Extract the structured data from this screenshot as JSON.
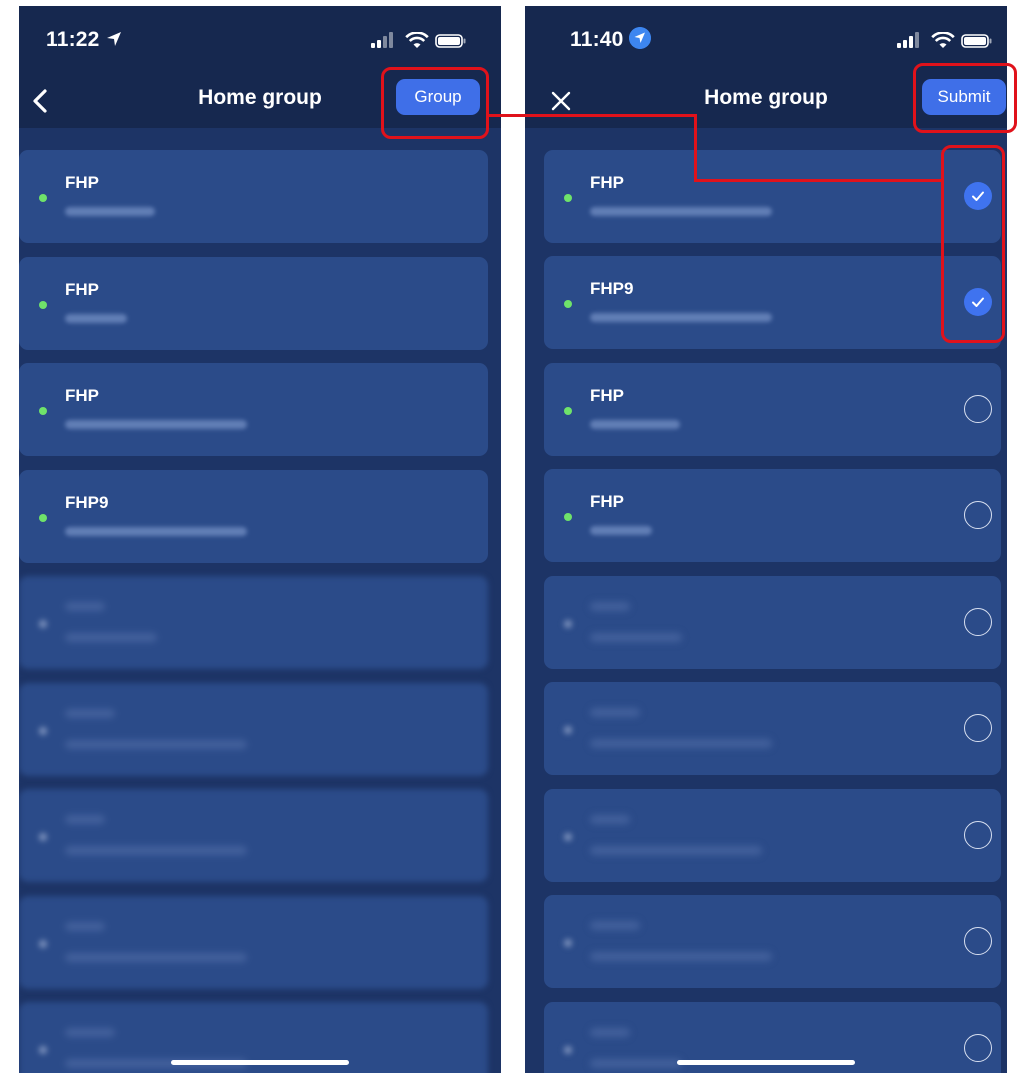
{
  "left_screen": {
    "status_time": "11:22",
    "nav_title": "Home group",
    "nav_button_label": "Group",
    "devices": [
      {
        "name": "FHP"
      },
      {
        "name": "FHP"
      },
      {
        "name": "FHP"
      },
      {
        "name": "FHP9"
      }
    ]
  },
  "right_screen": {
    "status_time": "11:40",
    "nav_title": "Home group",
    "nav_button_label": "Submit",
    "devices": [
      {
        "name": "FHP",
        "selected": true
      },
      {
        "name": "FHP9",
        "selected": true
      },
      {
        "name": "FHP",
        "selected": false
      },
      {
        "name": "FHP",
        "selected": false
      }
    ]
  },
  "colors": {
    "header_bg": "#16284f",
    "list_bg": "#1d3466",
    "card_bg": "#2b4b89",
    "accent_button": "#3f6fe8",
    "online_dot": "#6fe36a",
    "highlight_red": "#e0121b"
  },
  "icons": {
    "left_back": "chevron-left-icon",
    "right_close": "close-icon",
    "left_location": "location-arrow-icon",
    "right_location": "location-badge-icon",
    "checked": "check-circle-icon",
    "unchecked": "empty-circle-icon"
  }
}
